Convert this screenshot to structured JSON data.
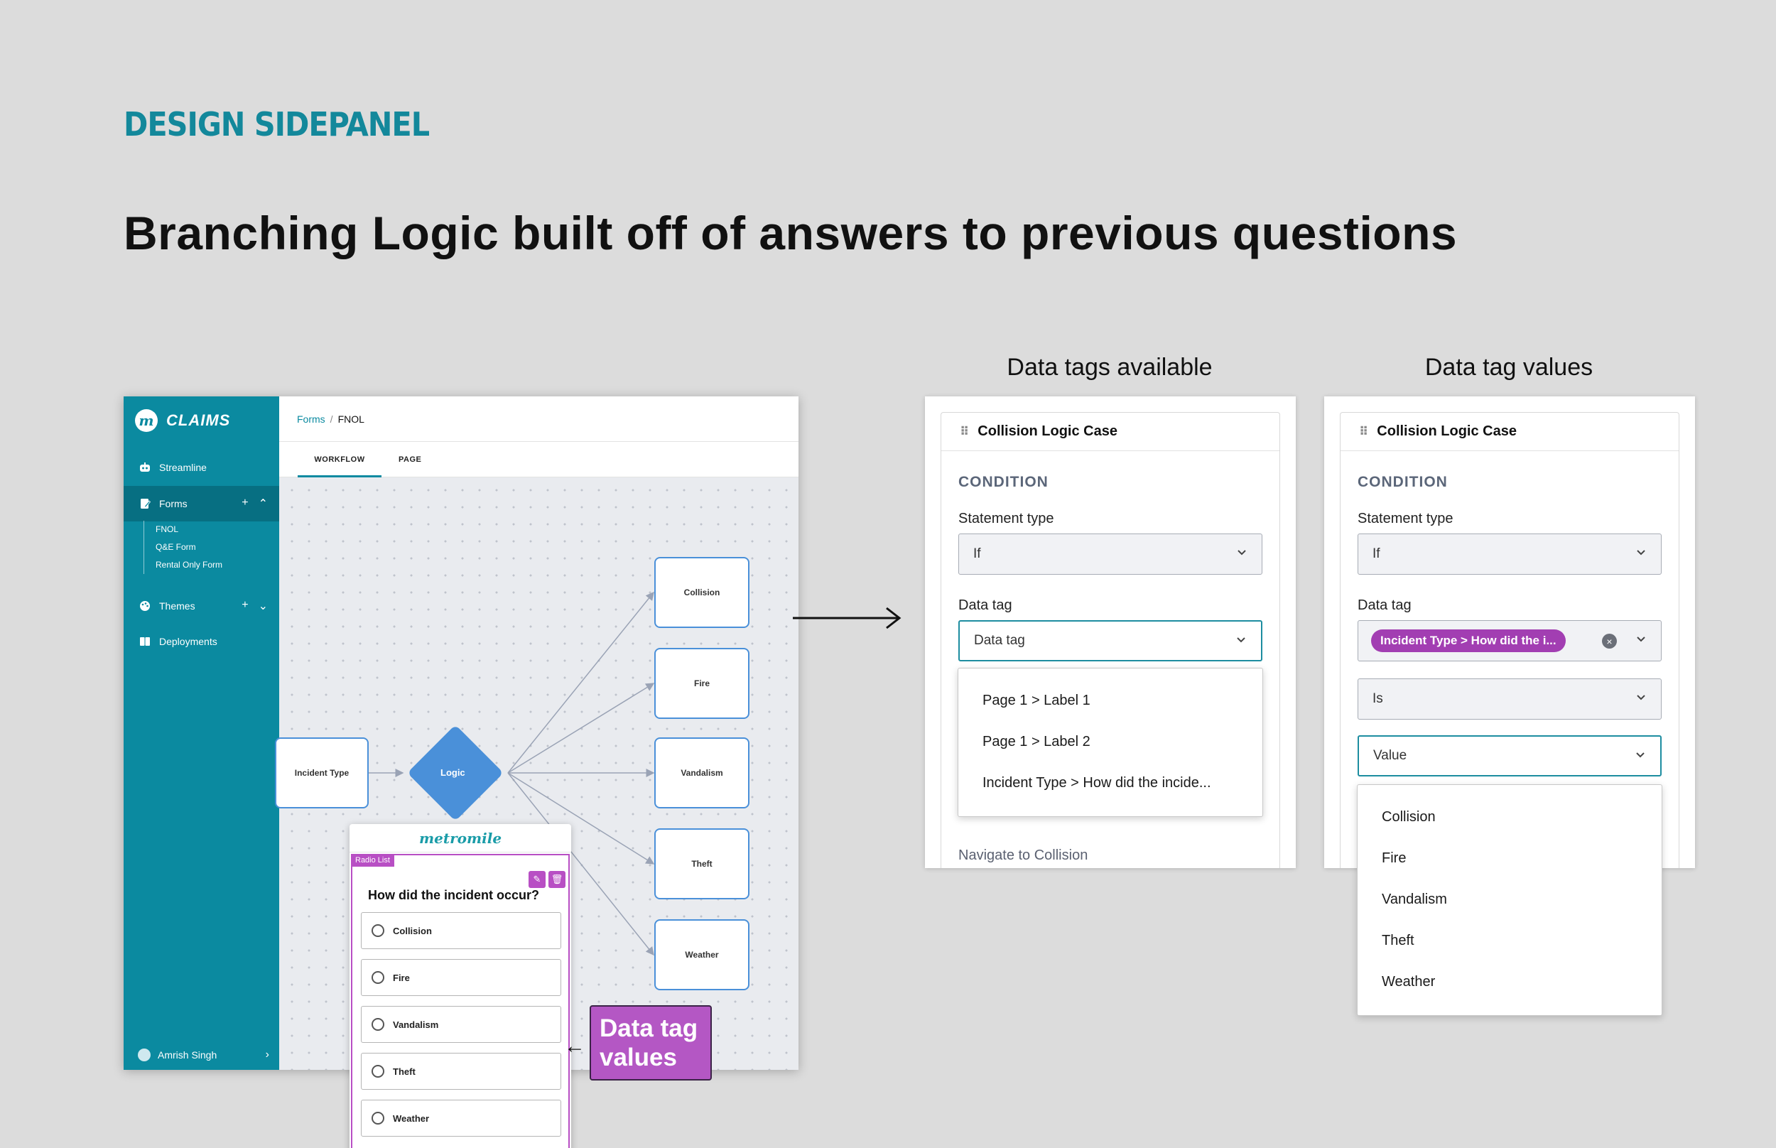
{
  "section_label": "DESIGN SIDEPANEL",
  "headline": "Branching Logic built off of answers to previous questions",
  "app": {
    "brand": "CLAIMS",
    "brand_logo": "m",
    "nav": {
      "streamline": "Streamline",
      "forms": "Forms",
      "themes": "Themes",
      "deployments": "Deployments"
    },
    "forms_children": [
      "FNOL",
      "Q&E Form",
      "Rental Only Form"
    ],
    "user": "Amrish Singh",
    "breadcrumb": {
      "root": "Forms",
      "separator": "/",
      "current": "FNOL"
    },
    "tabs": [
      "WORKFLOW",
      "PAGE"
    ],
    "workflow": {
      "source_node": "Incident Type",
      "logic_node": "Logic",
      "targets": [
        "Collision",
        "Fire",
        "Vandalism",
        "Theft",
        "Weather"
      ]
    },
    "form_preview": {
      "brand": "metromile",
      "block_tag": "Radio List",
      "question": "How did the incident occur?",
      "options": [
        "Collision",
        "Fire",
        "Vandalism",
        "Theft",
        "Weather"
      ]
    }
  },
  "callout": "Data tag values",
  "panel_available": {
    "title": "Data tags available",
    "card_title": "Collision Logic Case",
    "condition": "CONDITION",
    "statement_type_label": "Statement type",
    "statement_type_value": "If",
    "data_tag_label": "Data tag",
    "data_tag_placeholder": "Data tag",
    "options": [
      "Page 1 > Label 1",
      "Page 1 > Label 2",
      "Incident Type > How did the incide..."
    ],
    "navigate": "Navigate to Collision"
  },
  "panel_values": {
    "title": "Data tag values",
    "card_title": "Collision Logic Case",
    "condition": "CONDITION",
    "statement_type_label": "Statement type",
    "statement_type_value": "If",
    "data_tag_label": "Data tag",
    "data_tag_chip": "Incident Type > How did the i...",
    "operator_value": "Is",
    "value_placeholder": "Value",
    "options": [
      "Collision",
      "Fire",
      "Vandalism",
      "Theft",
      "Weather"
    ]
  },
  "colors": {
    "teal_sidebar": "#0b8aa0",
    "node_blue": "#4a90d9",
    "purple_accent": "#b457c4"
  }
}
